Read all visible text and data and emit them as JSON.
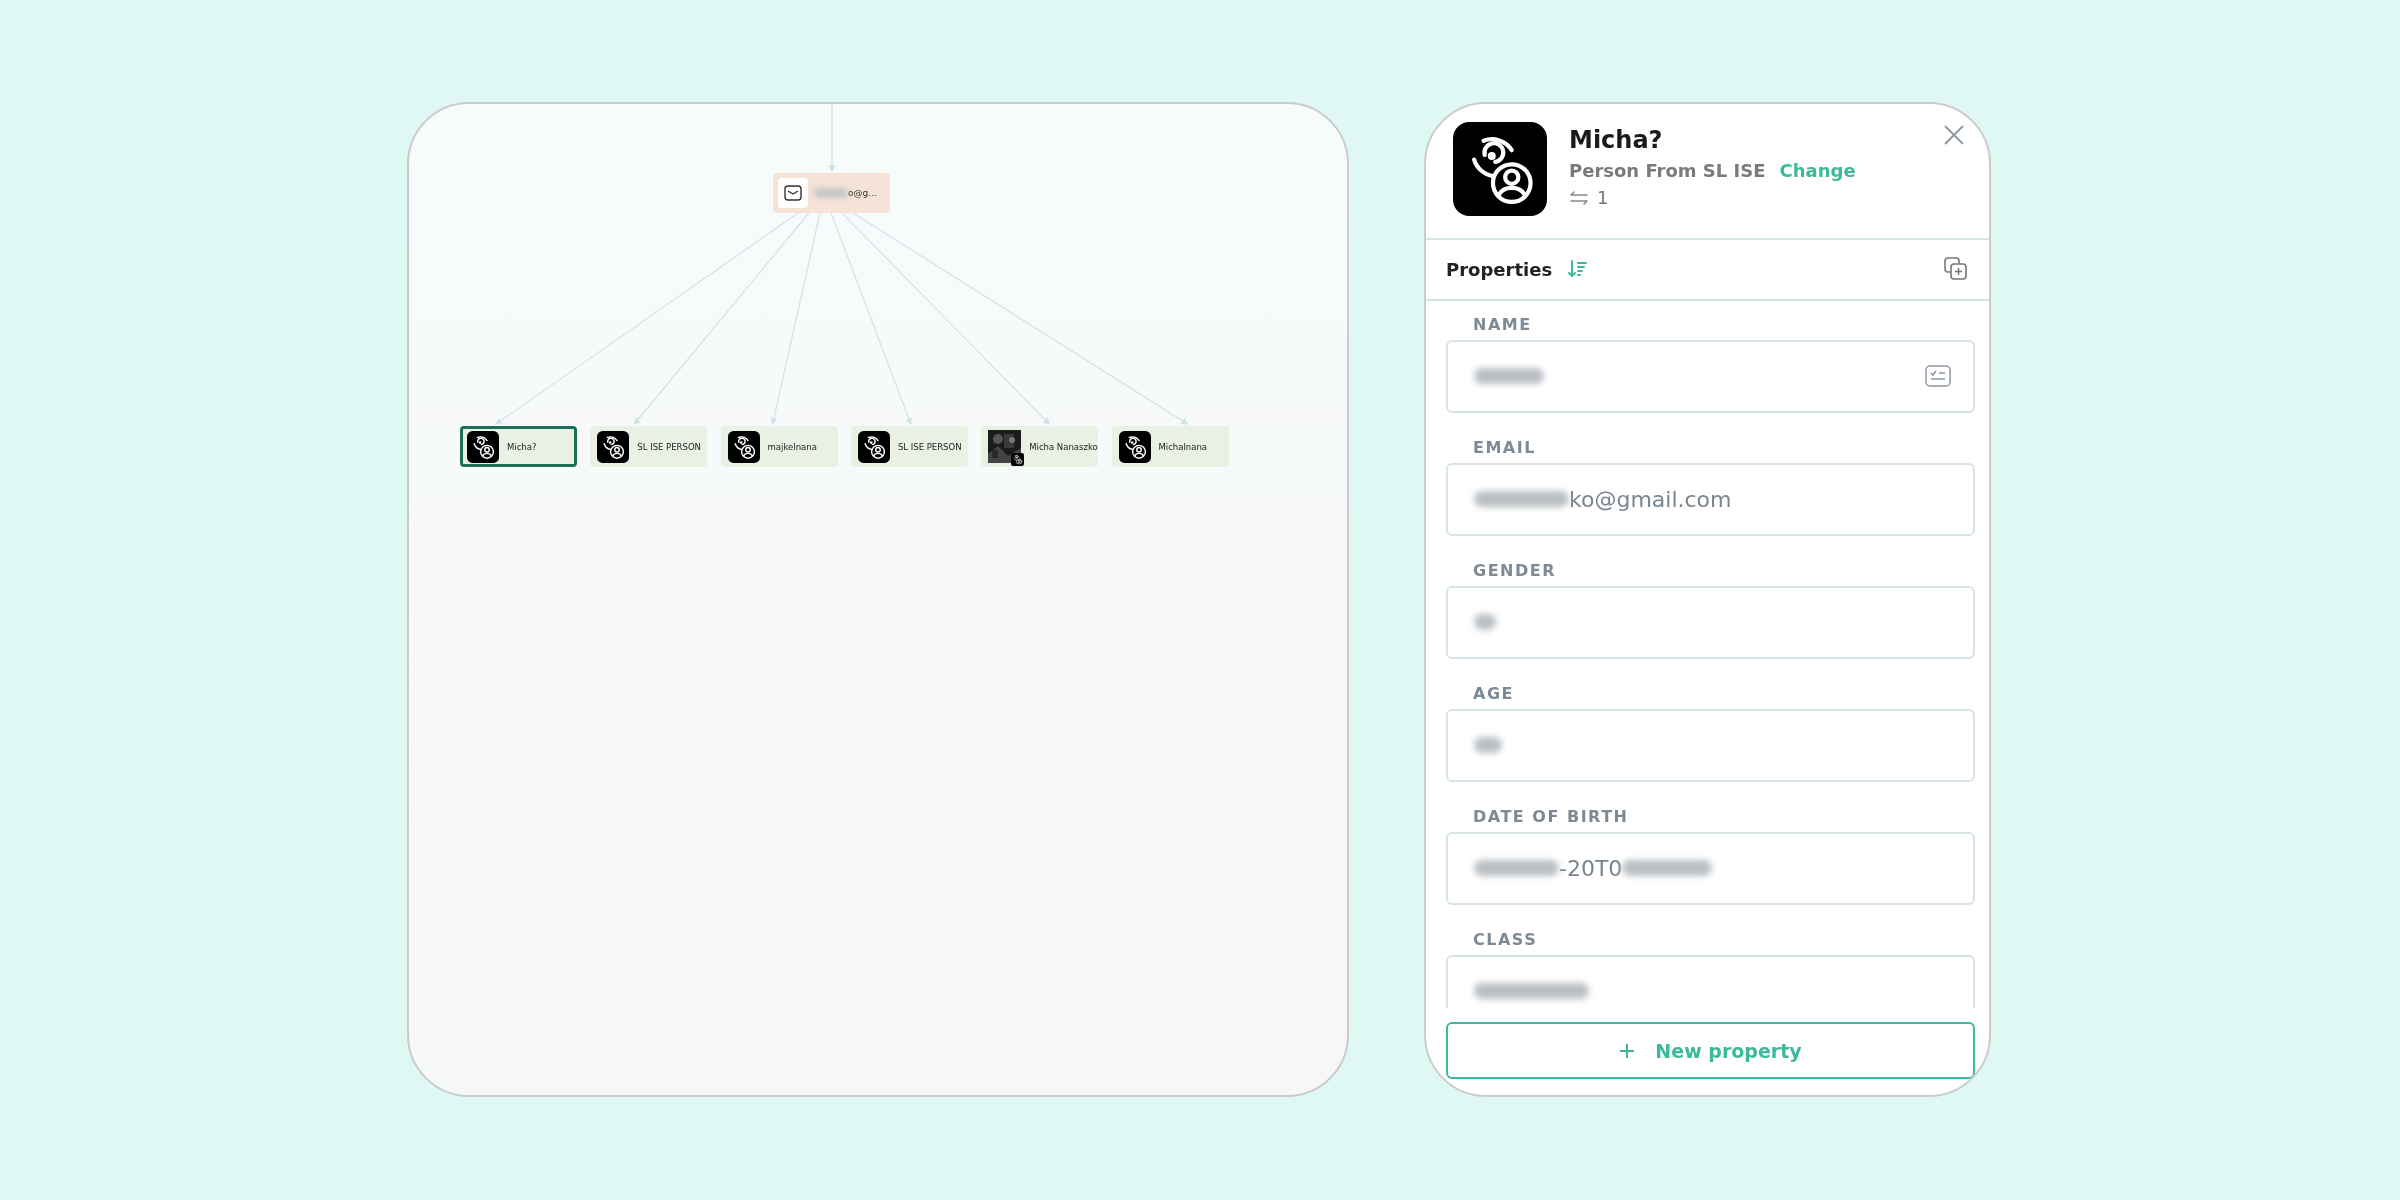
{
  "graph": {
    "root": {
      "kind": "email",
      "label": "o@g…"
    },
    "nodes": [
      {
        "kind": "icon",
        "label": "Micha?",
        "selected": true
      },
      {
        "kind": "icon",
        "label": "SL ISE PERSON",
        "selected": false
      },
      {
        "kind": "icon",
        "label": "majkelnana",
        "selected": false
      },
      {
        "kind": "icon",
        "label": "SL ISE PERSON",
        "selected": false
      },
      {
        "kind": "picture",
        "label": "Micha Nanaszko",
        "selected": false
      },
      {
        "kind": "icon",
        "label": "Michalnana",
        "selected": false
      }
    ]
  },
  "panel": {
    "title": "Micha?",
    "type": "Person From SL ISE",
    "change": "Change",
    "link_count": "1",
    "properties_title": "Properties",
    "fields": [
      {
        "label": "NAME",
        "action": true,
        "parts": [
          {
            "kind": "blur"
          }
        ]
      },
      {
        "label": "EMAIL",
        "action": false,
        "parts": [
          {
            "kind": "blur"
          },
          {
            "kind": "text",
            "text": "ko@gmail.com"
          }
        ]
      },
      {
        "label": "GENDER",
        "action": false,
        "parts": [
          {
            "kind": "blur"
          }
        ]
      },
      {
        "label": "AGE",
        "action": false,
        "parts": [
          {
            "kind": "blur"
          }
        ]
      },
      {
        "label": "DATE OF BIRTH",
        "action": false,
        "parts": [
          {
            "kind": "blur"
          },
          {
            "kind": "text",
            "text": "-20T0"
          },
          {
            "kind": "blur"
          }
        ]
      },
      {
        "label": "CLASS",
        "action": false,
        "parts": [
          {
            "kind": "blur"
          }
        ]
      }
    ],
    "new_property": "New property"
  }
}
